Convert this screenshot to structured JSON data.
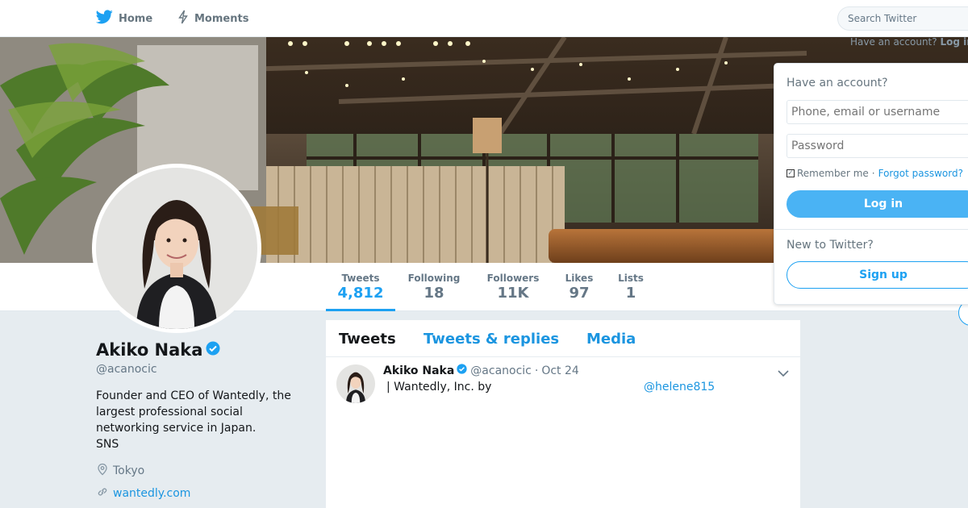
{
  "nav": {
    "home_label": "Home",
    "moments_label": "Moments",
    "search_placeholder": "Search Twitter",
    "have_account_top": "Have an account?",
    "login_top": "Log in"
  },
  "profile": {
    "name": "Akiko Naka",
    "handle": "@acanocic",
    "bio_lines": [
      "Founder and CEO of Wantedly, the",
      "largest professional social",
      "networking service in Japan.",
      "SNS"
    ],
    "location": "Tokyo",
    "url": "wantedly.com",
    "verified": true
  },
  "stats": [
    {
      "label": "Tweets",
      "value": "4,812",
      "active": true
    },
    {
      "label": "Following",
      "value": "18",
      "active": false
    },
    {
      "label": "Followers",
      "value": "11K",
      "active": false
    },
    {
      "label": "Likes",
      "value": "97",
      "active": false
    },
    {
      "label": "Lists",
      "value": "1",
      "active": false
    }
  ],
  "timeline": {
    "tabs": [
      "Tweets",
      "Tweets & replies",
      "Media"
    ],
    "tweet": {
      "name": "Akiko Naka",
      "handle": "@acanocic",
      "separator": "·",
      "date": "Oct 24",
      "text": "| Wantedly, Inc. by",
      "mention": "@helene815"
    }
  },
  "login": {
    "title": "Have an account?",
    "username_placeholder": "Phone, email or username",
    "password_placeholder": "Password",
    "remember_label": "Remember me",
    "separator": "·",
    "forgot_label": "Forgot password?",
    "login_button": "Log in",
    "new_label": "New to Twitter?",
    "signup_button": "Sign up"
  },
  "colors": {
    "accent": "#1da1f2",
    "link": "#1b95e0",
    "login_button": "#4ab3f4",
    "background": "#e6ecf0"
  },
  "icons": [
    "twitter-bird-icon",
    "lightning-icon",
    "verified-badge-icon",
    "location-pin-icon",
    "link-icon",
    "chevron-down-icon"
  ]
}
